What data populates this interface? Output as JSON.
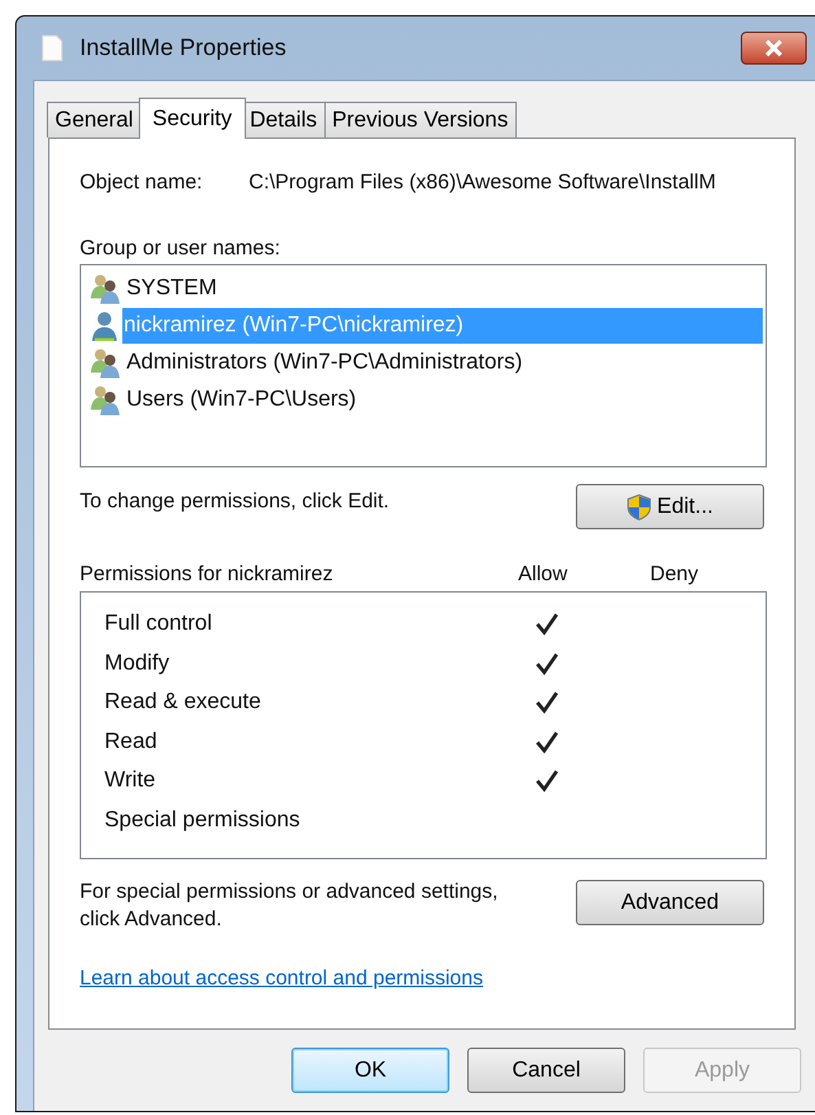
{
  "window": {
    "title": "InstallMe Properties"
  },
  "tabs": [
    {
      "label": "General",
      "selected": false
    },
    {
      "label": "Security",
      "selected": true
    },
    {
      "label": "Details",
      "selected": false
    },
    {
      "label": "Previous Versions",
      "selected": false
    }
  ],
  "object_name": {
    "label": "Object name:",
    "value": "C:\\Program Files (x86)\\Awesome Software\\InstallM"
  },
  "group_list": {
    "label": "Group or user names:",
    "items": [
      {
        "kind": "group",
        "name": "SYSTEM",
        "selected": false
      },
      {
        "kind": "user",
        "name": "nickramirez (Win7-PC\\nickramirez)",
        "selected": true
      },
      {
        "kind": "group",
        "name": "Administrators (Win7-PC\\Administrators)",
        "selected": false
      },
      {
        "kind": "group",
        "name": "Users (Win7-PC\\Users)",
        "selected": false
      }
    ]
  },
  "edit_hint": "To change permissions, click Edit.",
  "edit_button": "Edit...",
  "permissions": {
    "label": "Permissions for nickramirez",
    "allow_header": "Allow",
    "deny_header": "Deny",
    "rows": [
      {
        "name": "Full control",
        "allow": true,
        "deny": false
      },
      {
        "name": "Modify",
        "allow": true,
        "deny": false
      },
      {
        "name": "Read & execute",
        "allow": true,
        "deny": false
      },
      {
        "name": "Read",
        "allow": true,
        "deny": false
      },
      {
        "name": "Write",
        "allow": true,
        "deny": false
      },
      {
        "name": "Special permissions",
        "allow": false,
        "deny": false
      }
    ]
  },
  "advanced_hint": "For special permissions or advanced settings, click Advanced.",
  "advanced_button": "Advanced",
  "help_link": "Learn about access control and permissions",
  "buttons": [
    {
      "label": "OK",
      "default": true,
      "disabled": false
    },
    {
      "label": "Cancel",
      "default": false,
      "disabled": false
    },
    {
      "label": "Apply",
      "default": false,
      "disabled": true
    }
  ]
}
